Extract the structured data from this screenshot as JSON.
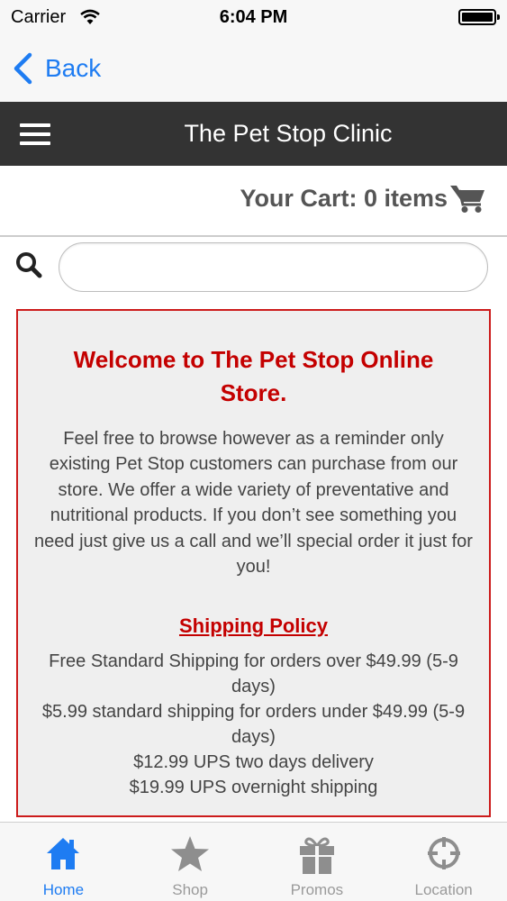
{
  "status_bar": {
    "carrier": "Carrier",
    "time": "6:04 PM"
  },
  "nav": {
    "back_label": "Back"
  },
  "header": {
    "title": "The Pet Stop Clinic"
  },
  "cart": {
    "label": "Your Cart: 0 items"
  },
  "search": {
    "placeholder": "",
    "value": ""
  },
  "welcome": {
    "title": "Welcome to The Pet Stop Online Store.",
    "body": "Feel free to browse however as a reminder only existing Pet Stop customers can purchase from our store. We offer a wide variety of preventative and nutritional products. If you don’t see something you need just give us a call and we’ll special order it just for you!",
    "policy_heading": "Shipping Policy",
    "policy_lines": [
      "Free Standard Shipping for orders over $49.99 (5-9 days)",
      "$5.99 standard shipping for orders under $49.99 (5-9 days)",
      "$12.99 UPS two days delivery",
      "$19.99 UPS overnight shipping"
    ]
  },
  "tabs": [
    {
      "label": "Home",
      "icon": "home-icon",
      "active": true
    },
    {
      "label": "Shop",
      "icon": "star-icon",
      "active": false
    },
    {
      "label": "Promos",
      "icon": "gift-icon",
      "active": false
    },
    {
      "label": "Location",
      "icon": "crosshair-icon",
      "active": false
    }
  ],
  "colors": {
    "accent": "#1e7cf2",
    "header_bg": "#333333",
    "brand_red": "#c40000"
  }
}
